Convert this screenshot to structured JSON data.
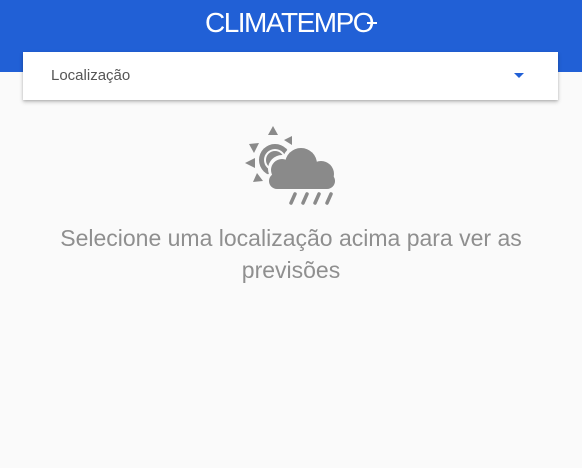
{
  "header": {
    "logo_text": "CLIMATEMPO",
    "color": "#2160d6"
  },
  "location_select": {
    "label": "Localização",
    "arrow_color": "#2160d6"
  },
  "empty_state": {
    "icon": "partly-sunny-rain-icon",
    "message": "Selecione uma localização acima para ver as previsões"
  }
}
